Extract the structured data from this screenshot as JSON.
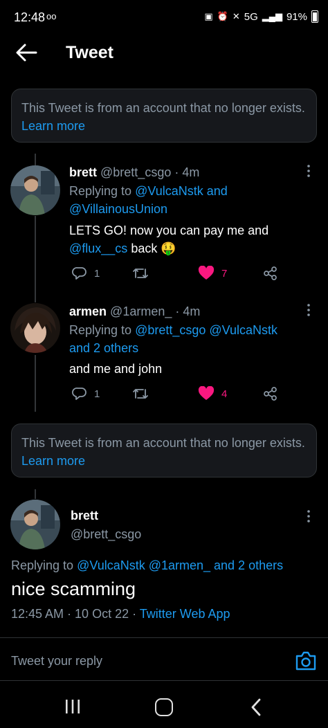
{
  "status_bar": {
    "time": "12:48",
    "icon_left": "oo",
    "network": "5G",
    "battery": "91%"
  },
  "header": {
    "title": "Tweet"
  },
  "notice_top": {
    "text": "This Tweet is from an account that no longer exists.",
    "link": "Learn more"
  },
  "tweets": [
    {
      "name": "brett",
      "handle": "@brett_csgo",
      "time": "4m",
      "replying_prefix": "Replying to",
      "replying_line1": "@VulcaNstk and",
      "replying_line2": "@VillainousUnion",
      "text_line1": "LETS GO! now you can pay me and",
      "text_link": "@flux__cs",
      "text_after": " back 🤑",
      "replies": "1",
      "likes": "7"
    },
    {
      "name": "armen",
      "handle": "@1armen_",
      "time": "4m",
      "replying_prefix": "Replying to",
      "replying_line1": "@brett_csgo @VulcaNstk",
      "replying_line2": "and 2 others",
      "text": "and me and john",
      "replies": "1",
      "likes": "4"
    }
  ],
  "notice_mid": {
    "text": "This Tweet is from an account that no longer exists.",
    "link": "Learn more"
  },
  "main_tweet": {
    "name": "brett",
    "handle": "@brett_csgo",
    "replying_prefix": "Replying to",
    "replying_link": "@VulcaNstk @1armen_ and 2 others",
    "text": "nice scamming",
    "meta": "12:45 AM · 10 Oct 22 · ",
    "source": "Twitter Web App"
  },
  "reply_bar": {
    "placeholder": "Tweet your reply"
  },
  "colors": {
    "accent": "#1d9bf0",
    "like": "#f91880",
    "muted": "#8b98a5"
  }
}
